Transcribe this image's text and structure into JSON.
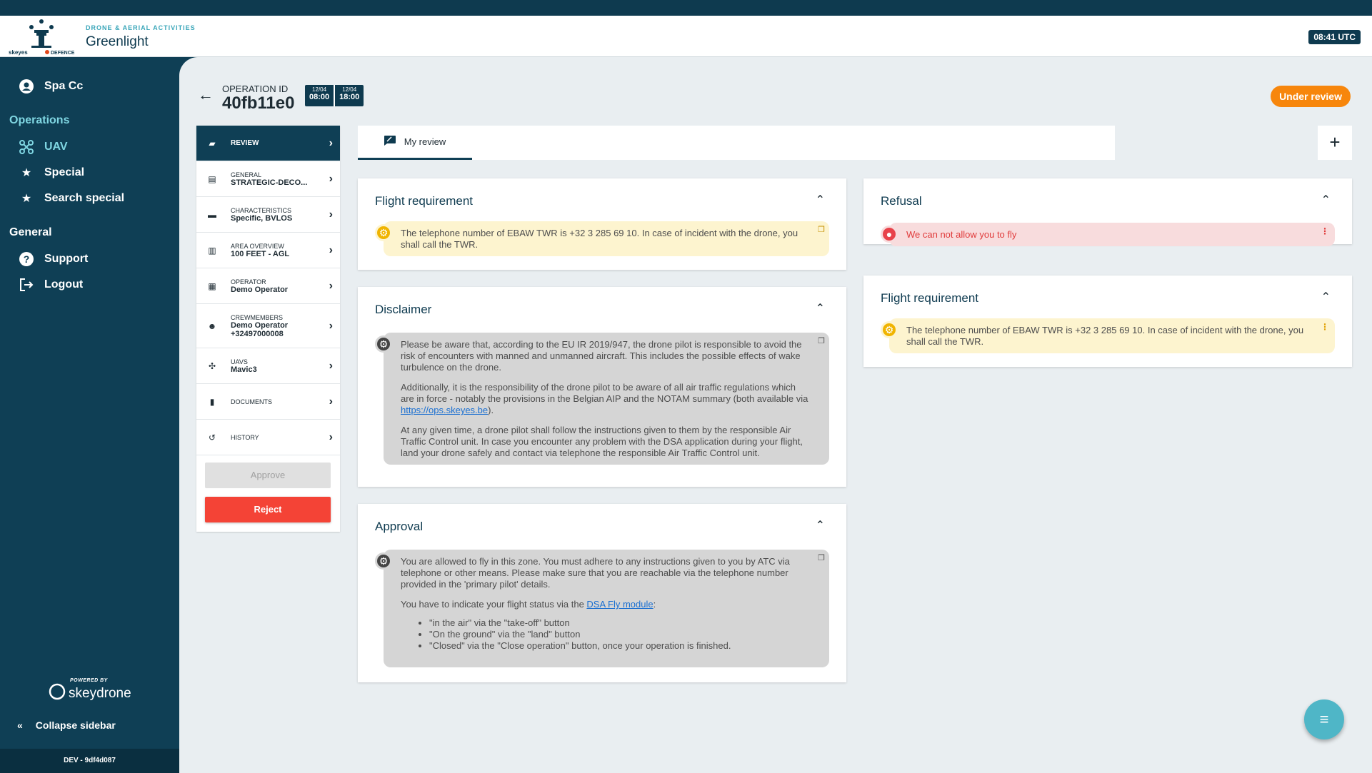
{
  "header": {
    "subtitle": "DRONE & AERIAL ACTIVITIES",
    "title": "Greenlight",
    "logo_text_left": "skeyes",
    "logo_text_right": "DEFENCE",
    "utc_time": "08:41 UTC"
  },
  "sidebar": {
    "user": "Spa Cc",
    "operations_title": "Operations",
    "operations": [
      {
        "label": "UAV",
        "icon": "drone-icon"
      },
      {
        "label": "Special",
        "icon": "star-icon"
      },
      {
        "label": "Search special",
        "icon": "search-star-icon"
      }
    ],
    "general_title": "General",
    "general": [
      {
        "label": "Support",
        "icon": "help-icon"
      },
      {
        "label": "Logout",
        "icon": "logout-icon"
      }
    ],
    "powered_by": "POWERED BY",
    "brand": "skeydrone",
    "collapse_label": "Collapse sidebar",
    "build": "DEV - 9df4d087"
  },
  "operation": {
    "label": "OPERATION ID",
    "id": "40fb11e0",
    "start_date": "12/04",
    "start_time": "08:00",
    "end_date": "12/04",
    "end_time": "18:00",
    "status": "Under review"
  },
  "steps": [
    {
      "label": "REVIEW",
      "value": "",
      "icon": "review-icon",
      "active": true
    },
    {
      "label": "GENERAL",
      "value": "STRATEGIC-DECO...",
      "icon": "list-icon"
    },
    {
      "label": "CHARACTERISTICS",
      "value": "Specific, BVLOS",
      "icon": "folder-icon"
    },
    {
      "label": "AREA OVERVIEW",
      "value": "100 FEET - AGL",
      "icon": "map-icon"
    },
    {
      "label": "OPERATOR",
      "value": "Demo Operator",
      "icon": "building-icon"
    },
    {
      "label": "CREWMEMBERS",
      "value": "Demo Operator",
      "value2": "+32497000008",
      "icon": "person-add-icon"
    },
    {
      "label": "UAVS",
      "value": "Mavic3",
      "icon": "drone-icon"
    },
    {
      "label": "DOCUMENTS",
      "value": "",
      "icon": "document-icon"
    },
    {
      "label": "HISTORY",
      "value": "",
      "icon": "history-icon"
    }
  ],
  "actions": {
    "approve": "Approve",
    "reject": "Reject"
  },
  "tabs": {
    "my_review": "My review"
  },
  "cards": {
    "flight_requirement": {
      "title": "Flight requirement",
      "text": "The telephone number of EBAW TWR is +32 3 285 69 10. In case of incident with the drone, you shall call the TWR."
    },
    "disclaimer": {
      "title": "Disclaimer",
      "p1": "Please be aware that, according to the EU IR 2019/947, the drone pilot is responsible to avoid the risk of encounters with manned and unmanned aircraft. This includes the possible effects of wake turbulence on the drone.",
      "p2_before": "Additionally, it is the responsibility of the drone pilot to be aware of all air traffic regulations which are in force - notably the provisions in the Belgian AIP and the NOTAM summary (both available via ",
      "p2_link": "https://ops.skeyes.be",
      "p2_after": ").",
      "p3": "At any given time, a drone pilot shall follow the instructions given to them by the responsible Air Traffic Control unit. In case you encounter any problem with the DSA application during your flight, land your drone safely and contact via telephone the responsible Air Traffic Control unit."
    },
    "approval": {
      "title": "Approval",
      "p1": "You are allowed to fly in this zone. You must adhere to any instructions given to you by ATC via telephone or other means. Please make sure that you are reachable via the telephone number provided in the 'primary pilot' details.",
      "p2_before": "You have to indicate your flight status via the ",
      "p2_link": "DSA Fly module",
      "p2_after": ":",
      "bullets": [
        "\"in the air\" via the \"take-off\" button",
        "\"On the ground\" via the \"land\" button",
        "\"Closed\" via the \"Close operation\" button, once your operation is finished."
      ]
    },
    "refusal": {
      "title": "Refusal",
      "text": "We can not allow you to fly"
    },
    "flight_requirement_right": {
      "title": "Flight requirement",
      "text": "The telephone number of EBAW TWR is +32 3 285 69 10. In case of incident with the drone, you shall call the TWR."
    }
  }
}
